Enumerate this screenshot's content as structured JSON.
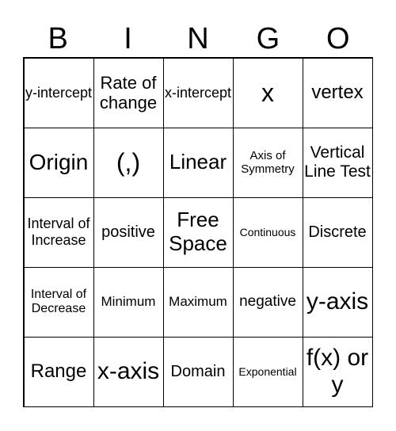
{
  "header": [
    "B",
    "I",
    "N",
    "G",
    "O"
  ],
  "cells": [
    "y-intercept",
    "Rate of change",
    "x-intercept",
    "x",
    "vertex",
    "Origin",
    "(,)",
    "Linear",
    "Axis of Symmetry",
    "Vertical Line Test",
    "Interval of Increase",
    "positive",
    "Free Space",
    "Continuous",
    "Discrete",
    "Interval of Decrease",
    "Minimum",
    "Maximum",
    "negative",
    "y-axis",
    "Range",
    "x-axis",
    "Domain",
    "Exponential",
    "f(x) or y"
  ]
}
